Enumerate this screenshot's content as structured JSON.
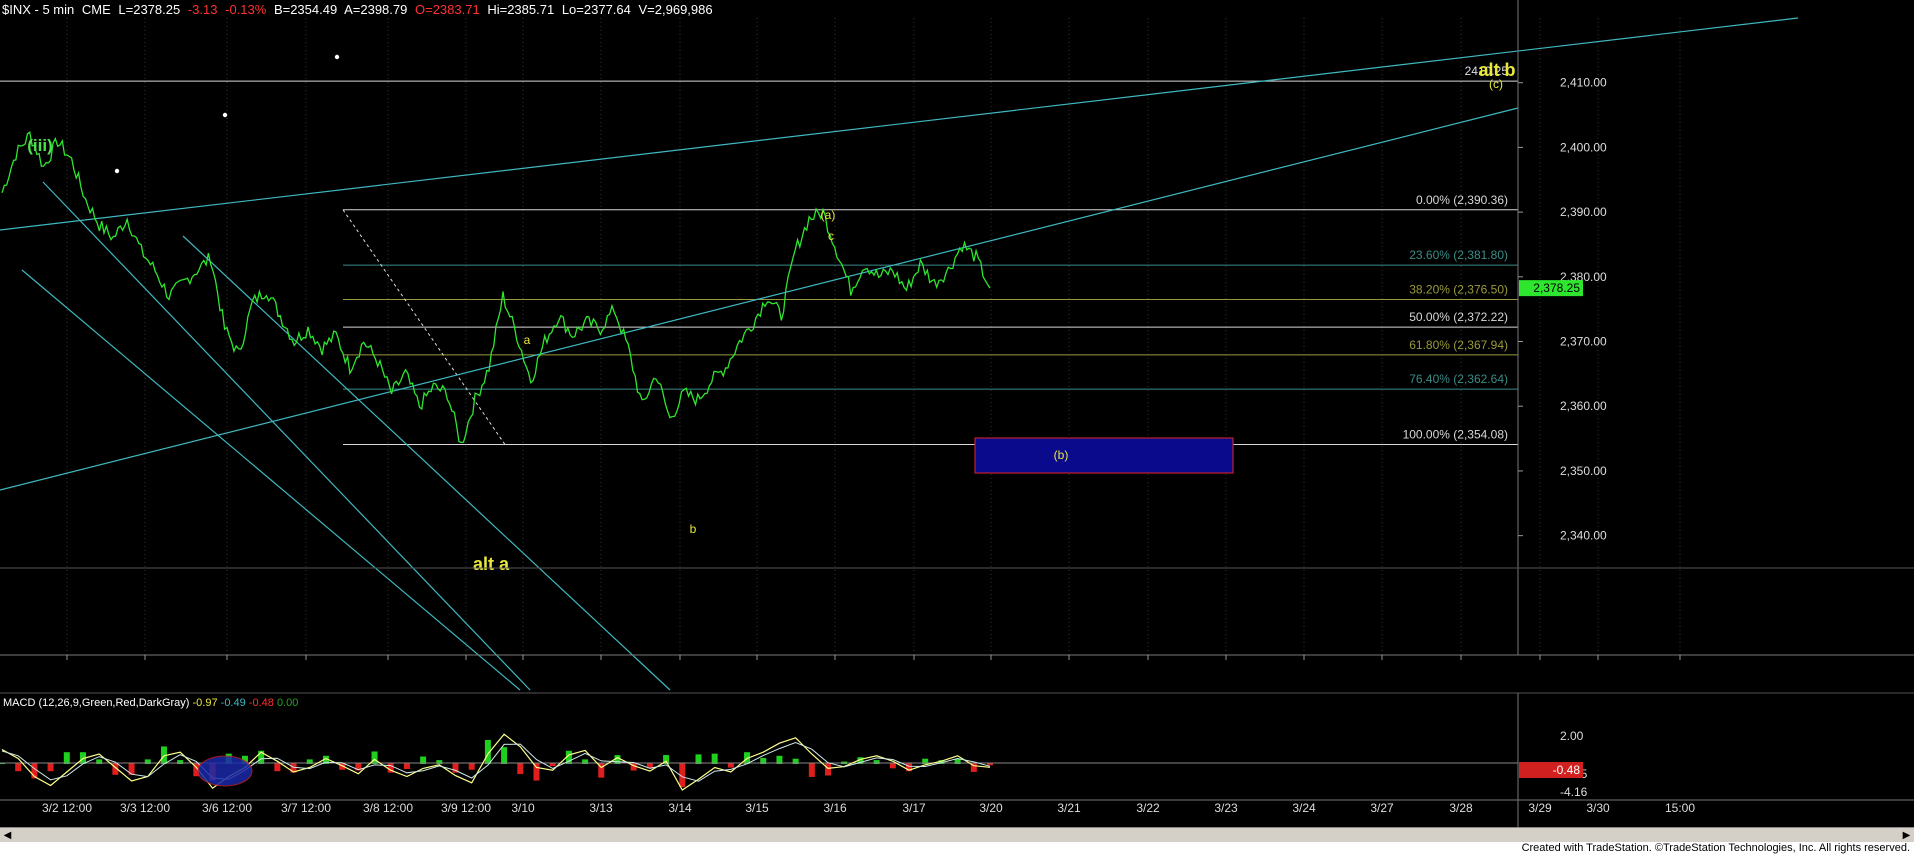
{
  "header": {
    "symbol": "$INX - 5 min",
    "exchange": "CME",
    "last": "L=2378.25",
    "change": "-3.13",
    "pct": "-0.13%",
    "bid": "B=2354.49",
    "ask": "A=2398.79",
    "open": "O=2383.71",
    "hi": "Hi=2385.71",
    "lo": "Lo=2377.64",
    "vol": "V=2,969,986"
  },
  "colors": {
    "price": "#2ee62e",
    "channel": "#3fb8c0",
    "fib_white": "#d8d8d8",
    "fib_olive": "#9a9a3c",
    "fib_teal": "#3a8c88",
    "label_yellow": "#e8e83c",
    "label_green": "#4ee04e",
    "box_fill": "#0a0a8c",
    "box_border": "#c0202c",
    "last_price_bg": "#2ee62e"
  },
  "chart_data": {
    "type": "line",
    "title": "$INX - 5 min",
    "ylim": [
      2335,
      2420
    ],
    "y_ticks": [
      "2,410.00",
      "2,400.00",
      "2,390.00",
      "2,380.00",
      "2,370.00",
      "2,360.00",
      "2,350.00",
      "2,340.00"
    ],
    "x_ticks": [
      "3/2 12:00",
      "3/3 12:00",
      "3/6 12:00",
      "3/7 12:00",
      "3/8 12:00",
      "3/9 12:00",
      "3/10",
      "3/13",
      "3/14",
      "3/15",
      "3/16",
      "3/17",
      "3/20",
      "3/21",
      "3/22",
      "3/23",
      "3/24",
      "3/27",
      "3/28",
      "3/29",
      "3/30",
      "15:00"
    ],
    "series": [
      {
        "values": [
          2393,
          2399,
          2402,
          2397,
          2401,
          2398,
          2392,
          2388,
          2386,
          2389,
          2384,
          2381,
          2377,
          2379,
          2381,
          2383,
          2372,
          2368,
          2376,
          2378,
          2374,
          2370,
          2372,
          2369,
          2371,
          2366,
          2370,
          2367,
          2362,
          2365,
          2360,
          2363,
          2362,
          2354,
          2361,
          2366,
          2377,
          2371,
          2364,
          2370,
          2374,
          2371,
          2373,
          2372,
          2375,
          2369,
          2360,
          2365,
          2358,
          2362,
          2361,
          2364,
          2366,
          2370,
          2373,
          2377,
          2374,
          2384,
          2389,
          2390,
          2384,
          2378,
          2382,
          2380,
          2381,
          2378,
          2382,
          2379,
          2381,
          2385,
          2383,
          2378.25
        ]
      }
    ],
    "fib_levels": [
      {
        "label": "0.00% (2,390.36)",
        "value": 2390.36
      },
      {
        "label": "23.60% (2,381.80)",
        "value": 2381.8
      },
      {
        "label": "38.20% (2,376.50)",
        "value": 2376.5
      },
      {
        "label": "50.00% (2,372.22)",
        "value": 2372.22
      },
      {
        "label": "61.80% (2,367.94)",
        "value": 2367.94
      },
      {
        "label": "76.40% (2,362.64)",
        "value": 2362.64
      },
      {
        "label": "100.00% (2,354.08)",
        "value": 2354.08
      }
    ],
    "horizontal_line": {
      "label": "2410.25",
      "value": 2410.25
    },
    "last_price": "2,378.25",
    "annotations": {
      "iii": "(iii)",
      "alt_a": "alt a",
      "alt_b": "alt b",
      "a": "a",
      "b": "b",
      "c": "c",
      "wave_a": "(a)",
      "wave_b": "(b)",
      "wave_c": "(c)"
    },
    "macd": {
      "title": "MACD (12,26,9,Green,Red,DarkGray)",
      "v1": "-0.97",
      "v2": "-0.49",
      "v3": "-0.48",
      "v4": "0.00",
      "y_ticks": [
        "2.00",
        "-2.45",
        "-4.16"
      ],
      "last_value": "-0.48",
      "values": [
        1.5,
        0.5,
        -1.5,
        -2.5,
        -1.0,
        0.5,
        1.0,
        -0.5,
        -2.0,
        -1.5,
        0.8,
        1.2,
        -0.5,
        -2.8,
        -1.5,
        -0.5,
        1.2,
        0.2,
        -1.0,
        -0.5,
        0.5,
        -0.3,
        -1.2,
        0.4,
        -0.8,
        -1.5,
        -0.6,
        -0.2,
        -1.4,
        -2.2,
        1.0,
        3.2,
        1.8,
        -0.5,
        -0.8,
        0.9,
        1.4,
        -0.5,
        0.6,
        -0.3,
        -0.9,
        0.2,
        -3.0,
        -1.8,
        -0.5,
        -1.0,
        0.5,
        1.2,
        2.2,
        2.8,
        1.0,
        -0.6,
        -0.4,
        0.4,
        0.8,
        0.2,
        -0.8,
        -0.2,
        0.2,
        0.8,
        -0.3,
        -0.48
      ]
    }
  },
  "footer": {
    "text": "Created with TradeStation. ©TradeStation Technologies, Inc. All rights reserved."
  }
}
